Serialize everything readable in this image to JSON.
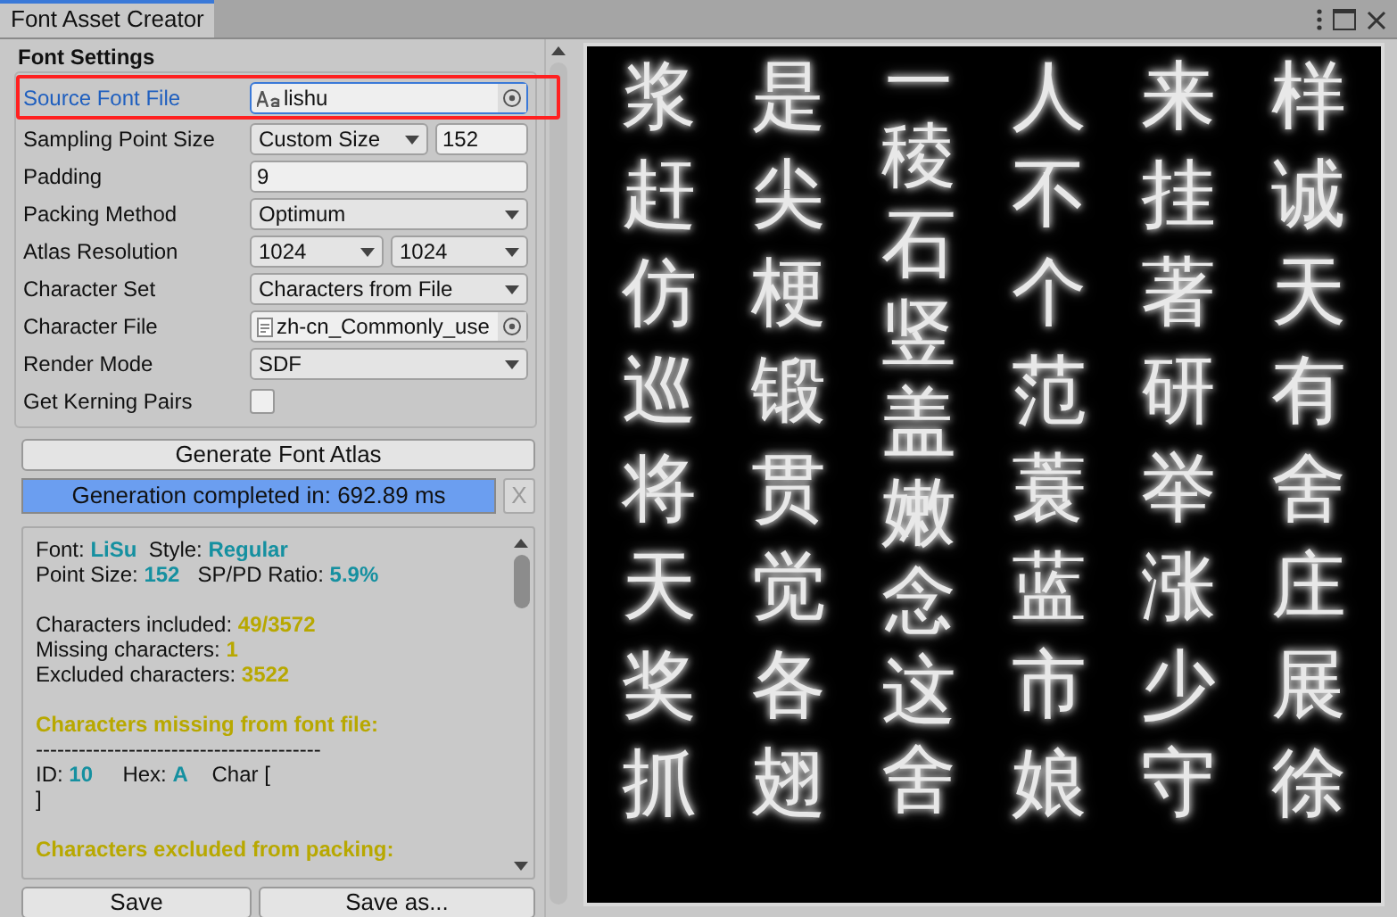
{
  "window": {
    "tab": "Font Asset Creator"
  },
  "section_title": "Font Settings",
  "settings": [
    {
      "label": "Source Font File",
      "kind": "font_object",
      "value": "lishu",
      "focused": true
    },
    {
      "label": "Sampling Point Size",
      "kind": "dropdown_number",
      "value": "Custom Size",
      "number": "152",
      "focused": false
    },
    {
      "label": "Padding",
      "kind": "text",
      "value": "9",
      "focused": false
    },
    {
      "label": "Packing Method",
      "kind": "dropdown",
      "value": "Optimum",
      "focused": false
    },
    {
      "label": "Atlas Resolution",
      "kind": "dual_dropdown",
      "value": "1024",
      "value_2": "1024",
      "focused": false
    },
    {
      "label": "Character Set",
      "kind": "dropdown",
      "value": "Characters from File",
      "focused": false
    },
    {
      "label": "Character File",
      "kind": "file_object",
      "value": "zh-cn_Commonly_use",
      "focused": false
    },
    {
      "label": "Render Mode",
      "kind": "dropdown",
      "value": "SDF",
      "focused": false
    },
    {
      "label": "Get Kerning Pairs",
      "kind": "checkbox",
      "checked": false,
      "focused": false
    }
  ],
  "generate_button": "Generate Font Atlas",
  "progress": {
    "text": "Generation completed in: 692.89 ms",
    "level": 1,
    "close": "X"
  },
  "info_blocks": [
    [
      {
        "segments": [
          {
            "text": "Font: ",
            "kind": "label"
          },
          {
            "text": "LiSu",
            "kind": "value"
          },
          {
            "text": "  Style: ",
            "kind": "label"
          },
          {
            "text": "Regular",
            "kind": "value"
          }
        ]
      },
      {
        "segments": [
          {
            "text": "Point Size: ",
            "kind": "label"
          },
          {
            "text": "152",
            "kind": "value"
          },
          {
            "text": "   SP/PD Ratio: ",
            "kind": "label"
          },
          {
            "text": "5.9%",
            "kind": "value"
          }
        ]
      }
    ],
    [
      {
        "segments": [
          {
            "text": "Characters included: ",
            "kind": "label"
          },
          {
            "text": "49/3572",
            "kind": "count"
          }
        ]
      },
      {
        "segments": [
          {
            "text": "Missing characters: ",
            "kind": "label"
          },
          {
            "text": "1",
            "kind": "count"
          }
        ]
      },
      {
        "segments": [
          {
            "text": "Excluded characters: ",
            "kind": "label"
          },
          {
            "text": "3522",
            "kind": "count"
          }
        ]
      }
    ],
    [
      {
        "segments": [
          {
            "text": "Characters missing from font file:",
            "kind": "heading"
          }
        ]
      },
      {
        "segments": [
          {
            "text": "----------------------------------------",
            "kind": "label"
          }
        ]
      },
      {
        "segments": [
          {
            "text": "ID: ",
            "kind": "label"
          },
          {
            "text": "10",
            "kind": "value"
          },
          {
            "text": "     Hex: ",
            "kind": "label"
          },
          {
            "text": "A",
            "kind": "value"
          },
          {
            "text": "    Char [",
            "kind": "label"
          }
        ]
      },
      {
        "segments": [
          {
            "text": "]",
            "kind": "label"
          }
        ]
      }
    ],
    [
      {
        "segments": [
          {
            "text": "Characters excluded from packing:",
            "kind": "heading"
          }
        ]
      }
    ]
  ],
  "save_buttons": [
    "Save",
    "Save as..."
  ],
  "atlas_columns": [
    [
      "浆",
      "赶",
      "仿",
      "巡",
      "将",
      "天",
      "奖",
      "抓"
    ],
    [
      "是",
      "尖",
      "梗",
      "锻",
      "贯",
      "觉",
      "各",
      "翅"
    ],
    [
      "一",
      "稜",
      "石",
      "竖",
      "盖",
      "嫩",
      "念",
      "这",
      "舍"
    ],
    [
      "人",
      "不",
      "个",
      "范",
      "蓑",
      "蓝",
      "市",
      "娘"
    ],
    [
      "来",
      "挂",
      "著",
      "研",
      "举",
      "涨",
      "少",
      "守"
    ],
    [
      "样",
      "诚",
      "天",
      "有",
      "舍",
      "庄",
      "展",
      "徐"
    ]
  ]
}
